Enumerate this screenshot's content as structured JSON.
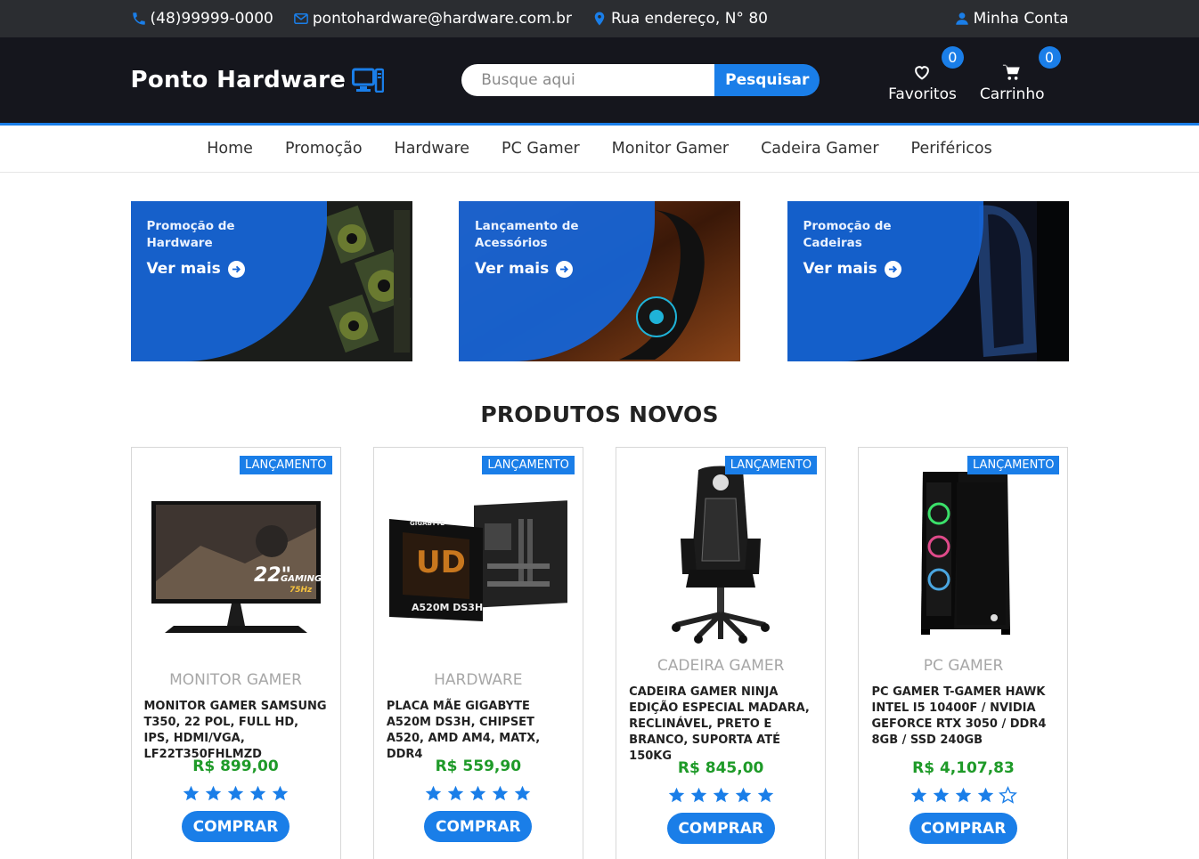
{
  "topbar": {
    "phone": "(48)99999-0000",
    "email": "pontohardware@hardware.com.br",
    "address": "Rua endereço, N° 80",
    "account": "Minha Conta"
  },
  "header": {
    "logo_text": "Ponto Hardware",
    "search_placeholder": "Busque aqui",
    "search_button": "Pesquisar",
    "favorites_label": "Favoritos",
    "favorites_count": "0",
    "cart_label": "Carrinho",
    "cart_count": "0"
  },
  "nav": [
    "Home",
    "Promoção",
    "Hardware",
    "PC Gamer",
    "Monitor Gamer",
    "Cadeira Gamer",
    "Periféricos"
  ],
  "banners": [
    {
      "title": "Promoção de Hardware",
      "cta": "Ver mais"
    },
    {
      "title": "Lançamento de Acessórios",
      "cta": "Ver mais"
    },
    {
      "title": "Promoção de Cadeiras",
      "cta": "Ver mais"
    }
  ],
  "section_title": "PRODUTOS NOVOS",
  "products": [
    {
      "tag": "LANÇAMENTO",
      "category": "MONITOR GAMER",
      "name": "MONITOR GAMER SAMSUNG T350, 22 POL, FULL HD, IPS, HDMI/VGA, LF22T350FHLMZD",
      "price": "R$ 899,00",
      "rating": 5,
      "button": "COMPRAR"
    },
    {
      "tag": "LANÇAMENTO",
      "category": "HARDWARE",
      "name": "PLACA MÃE GIGABYTE A520M DS3H, CHIPSET A520, AMD AM4, MATX, DDR4",
      "price": "R$ 559,90",
      "rating": 5,
      "button": "COMPRAR"
    },
    {
      "tag": "LANÇAMENTO",
      "category": "CADEIRA GAMER",
      "name": "CADEIRA GAMER NINJA EDIÇÃO ESPECIAL MADARA, RECLINÁVEL, PRETO E BRANCO, SUPORTA ATÉ 150KG",
      "price": "R$ 845,00",
      "rating": 5,
      "button": "COMPRAR"
    },
    {
      "tag": "LANÇAMENTO",
      "category": "PC GAMER",
      "name": "PC GAMER T-GAMER HAWK INTEL I5 10400F / NVIDIA GEFORCE RTX 3050 / DDR4 8GB / SSD 240GB",
      "price": "R$ 4,107,83",
      "rating": 4,
      "button": "COMPRAR"
    }
  ],
  "colors": {
    "accent": "#1a7ee8",
    "price": "#1e9a28",
    "header_bg": "#15161d",
    "topbar_bg": "#2b2d31"
  },
  "icons": [
    "phone-icon",
    "envelope-icon",
    "map-pin-icon",
    "user-icon",
    "monitor-icon",
    "heart-icon",
    "cart-icon",
    "arrow-circle-right-icon",
    "star-icon"
  ]
}
